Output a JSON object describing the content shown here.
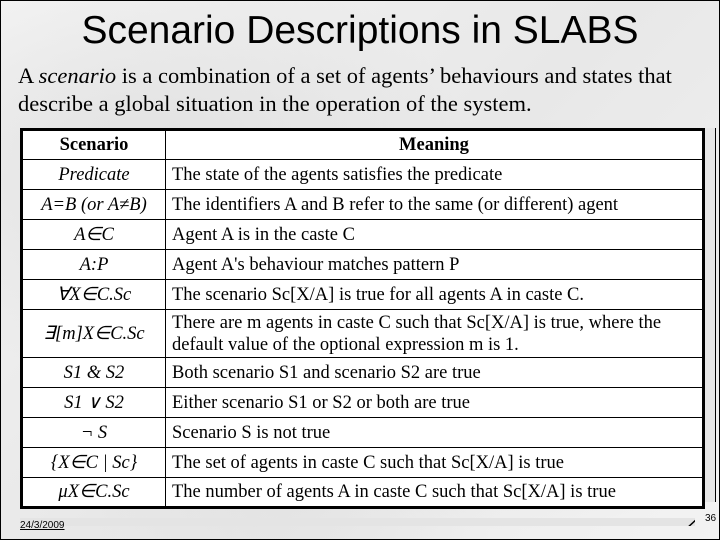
{
  "slide": {
    "title": "Scenario Descriptions in SLABS",
    "intro_prefix": "A ",
    "intro_term": "scenario",
    "intro_rest": " is a combination of a set of agents’ behaviours and states that describe a global situation in the operation of the system.",
    "date": "24/3/2009",
    "page_number": "36"
  },
  "table": {
    "headers": {
      "scenario": "Scenario",
      "meaning": "Meaning"
    },
    "rows": [
      {
        "scenario": "Predicate",
        "meaning": "The state of the agents satisfies the predicate"
      },
      {
        "scenario": "A=B (or A≠B)",
        "meaning": "The identifiers A and B refer to the same (or different) agent"
      },
      {
        "scenario": "A∈C",
        "meaning": "Agent A is in the caste C"
      },
      {
        "scenario": "A:P",
        "meaning": "Agent A's behaviour matches pattern P"
      },
      {
        "scenario": "∀X∈C.Sc",
        "meaning": "The scenario Sc[X/A] is true for all agents A in caste C."
      },
      {
        "scenario": "∃[m]X∈C.Sc",
        "meaning": "There are m agents in caste C such that Sc[X/A] is true, where the default value of the optional expression m is 1."
      },
      {
        "scenario": "S1 & S2",
        "meaning": "Both scenario S1 and scenario S2 are true"
      },
      {
        "scenario": "S1 ∨ S2",
        "meaning": "Either scenario S1 or S2 or both are true"
      },
      {
        "scenario": "¬ S",
        "meaning": "Scenario S is not true"
      },
      {
        "scenario": "{X∈C | Sc}",
        "meaning": "The set of agents in caste C such that Sc[X/A] is true"
      },
      {
        "scenario": "μX∈C.Sc",
        "meaning": "The number of agents A in caste C such that Sc[X/A] is true"
      }
    ]
  }
}
